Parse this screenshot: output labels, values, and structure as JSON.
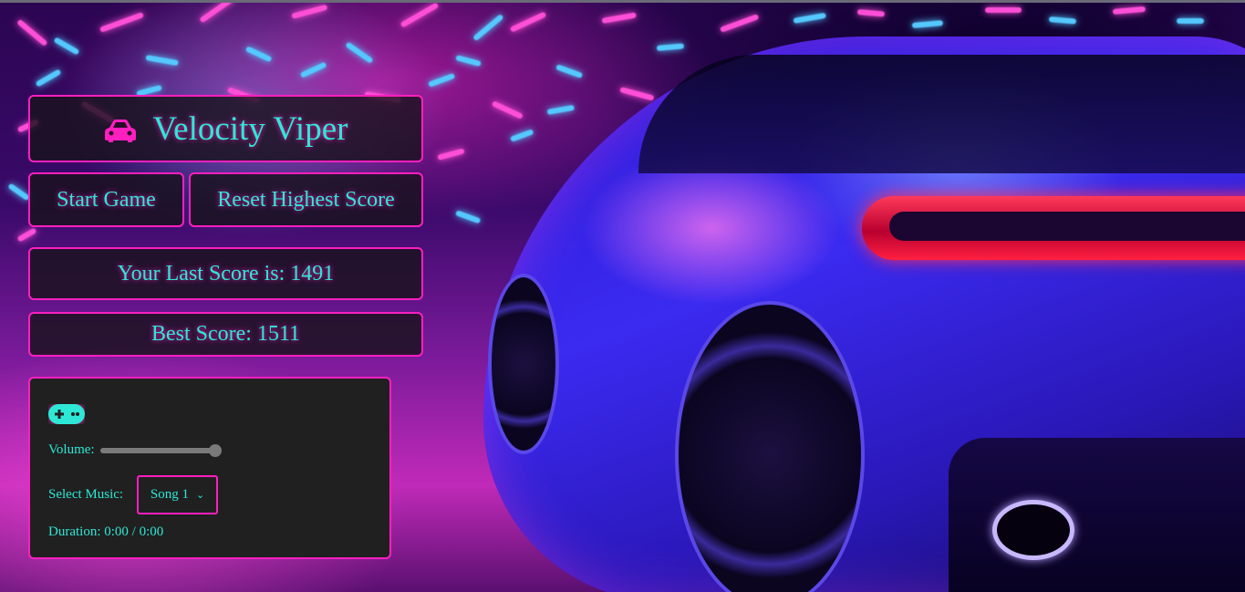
{
  "title": {
    "icon": "car-icon",
    "text": "Velocity Viper"
  },
  "buttons": {
    "start_label": "Start Game",
    "reset_label": "Reset Highest Score"
  },
  "scores": {
    "last_label": "Your Last Score is:",
    "last_value": "1491",
    "best_label": "Best Score:",
    "best_value": "1511"
  },
  "music": {
    "icon": "gamepad-icon",
    "volume_label": "Volume:",
    "volume_level": 1.0,
    "select_label": "Select Music:",
    "selected_song": "Song 1",
    "duration_label": "Duration:",
    "duration_value": "0:00 / 0:00"
  },
  "colors": {
    "accent_text": "#2ee8d6",
    "border": "#ff1fbf",
    "panel_bg": "#202020"
  }
}
